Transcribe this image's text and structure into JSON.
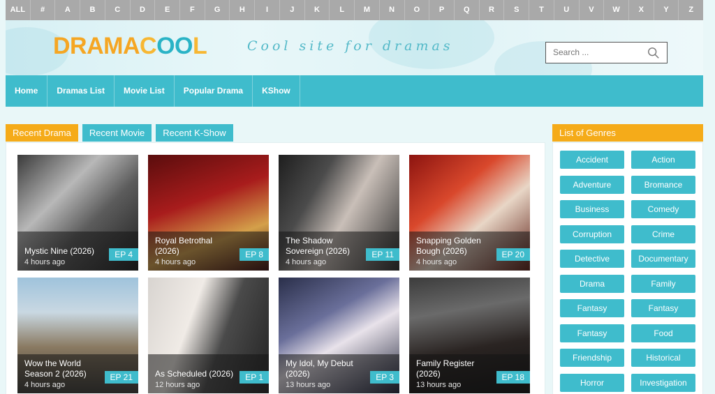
{
  "alphabet": [
    "ALL",
    "#",
    "A",
    "B",
    "C",
    "D",
    "E",
    "F",
    "G",
    "H",
    "I",
    "J",
    "K",
    "L",
    "M",
    "N",
    "O",
    "P",
    "Q",
    "R",
    "S",
    "T",
    "U",
    "V",
    "W",
    "X",
    "Y",
    "Z"
  ],
  "header": {
    "logo_part1": "DRAMA",
    "logo_part2": "C",
    "logo_oo": "OO",
    "logo_part3": "L",
    "tagline": "Cool site for dramas",
    "search_placeholder": "Search ..."
  },
  "nav": [
    "Home",
    "Dramas List",
    "Movie List",
    "Popular Drama",
    "KShow"
  ],
  "tabs": [
    "Recent Drama",
    "Recent Movie",
    "Recent K-Show"
  ],
  "cards": [
    {
      "title": "Mystic Nine (2026)",
      "time": "4 hours ago",
      "ep": "EP 4"
    },
    {
      "title": "Royal Betrothal (2026)",
      "time": "4 hours ago",
      "ep": "EP 8"
    },
    {
      "title": "The Shadow Sovereign (2026)",
      "time": "4 hours ago",
      "ep": "EP 11"
    },
    {
      "title": "Snapping Golden Bough (2026)",
      "time": "4 hours ago",
      "ep": "EP 20"
    },
    {
      "title": "Wow the World Season 2 (2026)",
      "time": "4 hours ago",
      "ep": "EP 21"
    },
    {
      "title": "As Scheduled (2026)",
      "time": "12 hours ago",
      "ep": "EP 1"
    },
    {
      "title": "My Idol, My Debut (2026)",
      "time": "13 hours ago",
      "ep": "EP 3"
    },
    {
      "title": "Family Register (2026)",
      "time": "13 hours ago",
      "ep": "EP 18"
    }
  ],
  "genres_title": "List of Genres",
  "genres": [
    "Accident",
    "Action",
    "Adventure",
    "Bromance",
    "Business",
    "Comedy",
    "Corruption",
    "Crime",
    "Detective",
    "Documentary",
    "Drama",
    "Family",
    "Fantasy",
    "Fantasy",
    "Fantasy",
    "Food",
    "Friendship",
    "Historical",
    "Horror",
    "Investigation"
  ],
  "colors": {
    "accent_teal": "#3fbccc",
    "accent_orange": "#f5ab19",
    "alphabet_bar": "#a9a9a9"
  }
}
